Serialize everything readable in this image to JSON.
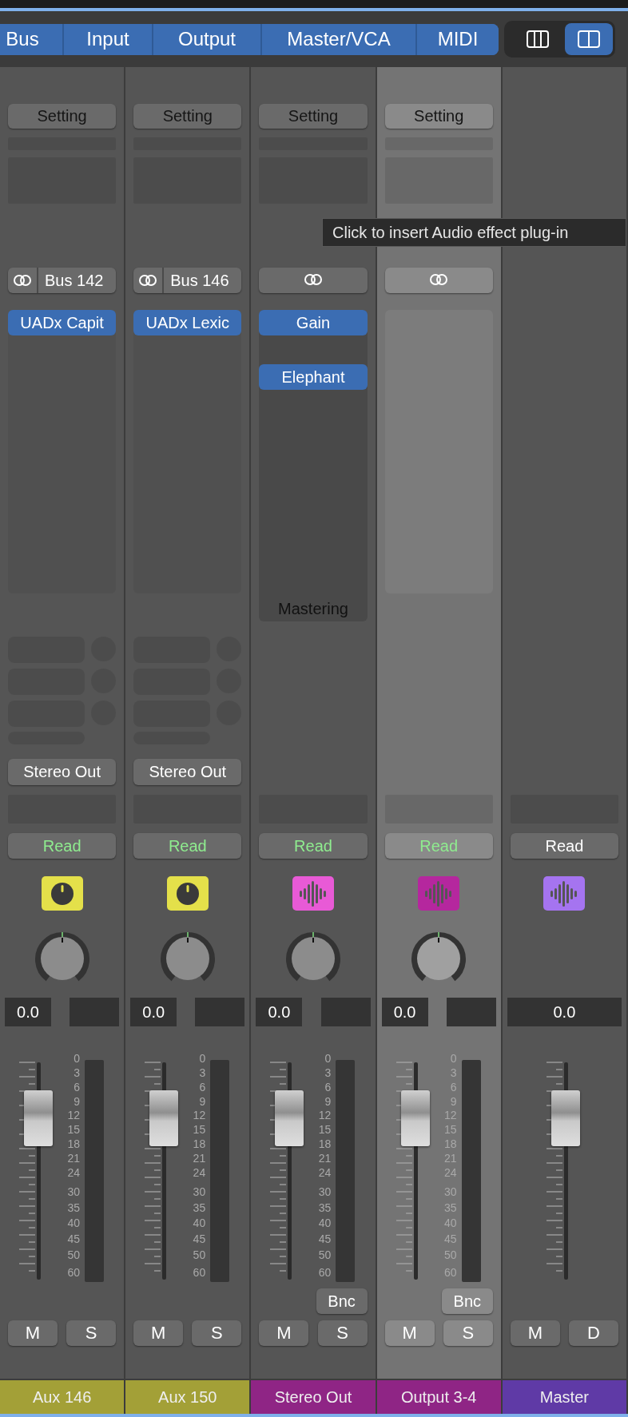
{
  "top_bar": {
    "tabs": [
      {
        "label": "Bus",
        "on": true
      },
      {
        "label": "Input",
        "on": true
      },
      {
        "label": "Output",
        "on": true
      },
      {
        "label": "Master/VCA",
        "on": true
      },
      {
        "label": "MIDI",
        "on": true
      }
    ],
    "view_buttons": [
      {
        "kind": "columns3",
        "selected": false
      },
      {
        "kind": "columns2",
        "selected": true
      }
    ]
  },
  "strips": [
    {
      "kind": "aux",
      "selected": false,
      "setting": "Setting",
      "input": {
        "kind": "stereo",
        "label": "Bus 142"
      },
      "inserts": [
        {
          "kind": "plugin",
          "name": "UADx Capit"
        }
      ],
      "output": "Stereo Out",
      "automation": {
        "label": "Read",
        "active": true
      },
      "icon": {
        "kind": "knob",
        "color": "#e4e04a"
      },
      "volume": "0.0",
      "fader": {
        "level": 0.74
      },
      "meter_scale": [
        "0",
        "3",
        "6",
        "9",
        "12",
        "15",
        "18",
        "21",
        "24",
        "30",
        "35",
        "40",
        "45",
        "50",
        "60"
      ],
      "buttons": [
        "M",
        "S"
      ],
      "name": "Aux 146",
      "color": "#a3a037"
    },
    {
      "kind": "aux",
      "selected": false,
      "setting": "Setting",
      "input": {
        "kind": "stereo",
        "label": "Bus 146"
      },
      "inserts": [
        {
          "kind": "plugin",
          "name": "UADx Lexic"
        }
      ],
      "output": "Stereo Out",
      "automation": {
        "label": "Read",
        "active": true
      },
      "icon": {
        "kind": "knob",
        "color": "#e4e04a"
      },
      "volume": "0.0",
      "fader": {
        "level": 0.74
      },
      "meter_scale": [
        "0",
        "3",
        "6",
        "9",
        "12",
        "15",
        "18",
        "21",
        "24",
        "30",
        "35",
        "40",
        "45",
        "50",
        "60"
      ],
      "buttons": [
        "M",
        "S"
      ],
      "name": "Aux 150",
      "color": "#a3a037"
    },
    {
      "kind": "output",
      "selected": false,
      "setting": "Setting",
      "input": {
        "kind": "stereo"
      },
      "inserts": [
        {
          "kind": "plugin",
          "name": "Gain"
        },
        {
          "kind": "empty"
        },
        {
          "kind": "plugin",
          "name": "Elephant"
        }
      ],
      "insert_group": "Mastering",
      "automation": {
        "label": "Read",
        "active": true
      },
      "icon": {
        "kind": "waveform",
        "color": "#e85ad6"
      },
      "volume": "0.0",
      "fader": {
        "level": 0.74
      },
      "meter_scale": [
        "0",
        "3",
        "6",
        "9",
        "12",
        "15",
        "18",
        "21",
        "24",
        "30",
        "35",
        "40",
        "45",
        "50",
        "60"
      ],
      "bounce": "Bnc",
      "buttons": [
        "M",
        "S"
      ],
      "name": "Stereo Out",
      "color": "#8f2585"
    },
    {
      "kind": "output",
      "selected": true,
      "setting": "Setting",
      "input": {
        "kind": "stereo"
      },
      "automation": {
        "label": "Read",
        "active": true
      },
      "icon": {
        "kind": "waveform",
        "color": "#b5279e"
      },
      "volume": "0.0",
      "fader": {
        "level": 0.74
      },
      "meter_scale": [
        "0",
        "3",
        "6",
        "9",
        "12",
        "15",
        "18",
        "21",
        "24",
        "30",
        "35",
        "40",
        "45",
        "50",
        "60"
      ],
      "bounce": "Bnc",
      "buttons": [
        "M",
        "S"
      ],
      "name": "Output 3-4",
      "color": "#8f2585"
    },
    {
      "kind": "master",
      "selected": false,
      "automation": {
        "label": "Read",
        "active": false
      },
      "icon": {
        "kind": "waveform",
        "color": "#a574f0"
      },
      "volume": "0.0",
      "fader": {
        "level": 0.74
      },
      "buttons": [
        "M",
        "D"
      ],
      "name": "Master",
      "color": "#5f3aa6"
    }
  ],
  "tooltip": {
    "text": "Click to insert Audio effect plug-in"
  }
}
